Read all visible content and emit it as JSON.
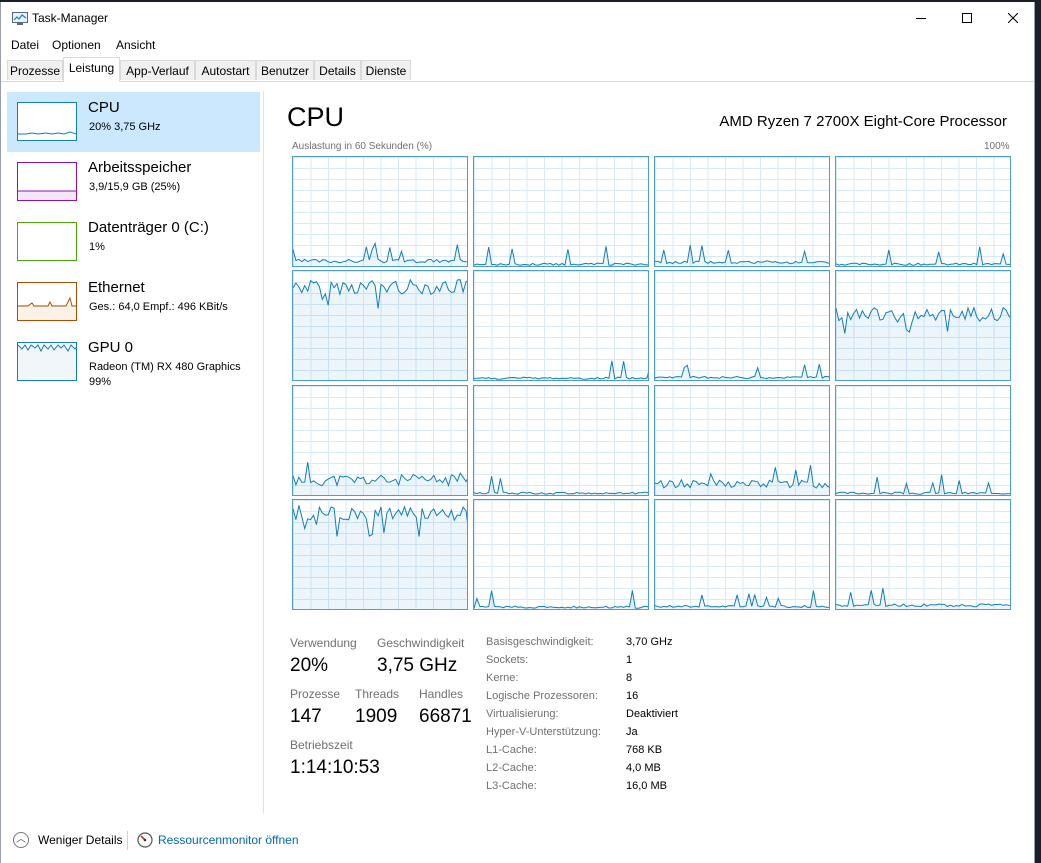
{
  "window": {
    "title": "Task-Manager"
  },
  "menu": [
    "Datei",
    "Optionen",
    "Ansicht"
  ],
  "tabs": [
    "Prozesse",
    "Leistung",
    "App-Verlauf",
    "Autostart",
    "Benutzer",
    "Details",
    "Dienste"
  ],
  "active_tab": "Leistung",
  "sidebar": [
    {
      "title": "CPU",
      "sub1": "20% 3,75 GHz",
      "sub2": "",
      "color": "#117dbb",
      "selected": true
    },
    {
      "title": "Arbeitsspeicher",
      "sub1": "3,9/15,9 GB (25%)",
      "sub2": "",
      "color": "#8b12ae",
      "selected": false
    },
    {
      "title": "Datenträger 0 (C:)",
      "sub1": "1%",
      "sub2": "",
      "color": "#4da60c",
      "selected": false
    },
    {
      "title": "Ethernet",
      "sub1": "Ges.: 64,0 Empf.: 496 KBit/s",
      "sub2": "",
      "color": "#a74f01",
      "selected": false
    },
    {
      "title": "GPU 0",
      "sub1": "Radeon (TM) RX 480 Graphics",
      "sub2": "99%",
      "color": "#117dbb",
      "selected": false
    }
  ],
  "main": {
    "title": "CPU",
    "processor": "AMD Ryzen 7 2700X Eight-Core Processor",
    "graph_label": "Auslastung in 60 Sekunden (%)",
    "graph_max": "100%"
  },
  "cores_approx_load_percent": [
    4,
    1,
    3,
    1,
    90,
    1,
    2,
    64,
    12,
    1,
    9,
    1,
    93,
    1,
    2,
    3
  ],
  "stats": {
    "usage_label": "Verwendung",
    "usage_value": "20%",
    "speed_label": "Geschwindigkeit",
    "speed_value": "3,75 GHz",
    "processes_label": "Prozesse",
    "processes_value": "147",
    "threads_label": "Threads",
    "threads_value": "1909",
    "handles_label": "Handles",
    "handles_value": "66871",
    "uptime_label": "Betriebszeit",
    "uptime_value": "1:14:10:53"
  },
  "info": [
    {
      "label": "Basisgeschwindigkeit:",
      "value": "3,70 GHz"
    },
    {
      "label": "Sockets:",
      "value": "1"
    },
    {
      "label": "Kerne:",
      "value": "8"
    },
    {
      "label": "Logische Prozessoren:",
      "value": "16"
    },
    {
      "label": "Virtualisierung:",
      "value": "Deaktiviert"
    },
    {
      "label": "Hyper-V-Unterstützung:",
      "value": "Ja"
    },
    {
      "label": "L1-Cache:",
      "value": "768 KB"
    },
    {
      "label": "L2-Cache:",
      "value": "4,0 MB"
    },
    {
      "label": "L3-Cache:",
      "value": "16,0 MB"
    }
  ],
  "footer": {
    "fewer_details": "Weniger Details",
    "resource_monitor": "Ressourcenmonitor öffnen"
  }
}
